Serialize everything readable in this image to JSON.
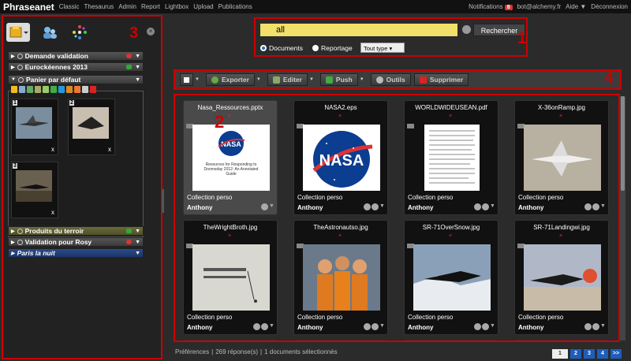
{
  "topbar": {
    "app_name": "Phraseanet",
    "nav": [
      "Classic",
      "Thesaurus",
      "Admin",
      "Report",
      "Lightbox",
      "Upload",
      "Publications"
    ],
    "notifications_label": "Notifications",
    "notifications_count": "8",
    "user": "bot@alchemy.fr",
    "help": "Aide ▼",
    "logout": "Déconnexion"
  },
  "callouts": {
    "search": "1",
    "results": "2",
    "left_panel": "3",
    "toolbar": "4"
  },
  "search": {
    "value": "all",
    "button": "Rechercher",
    "radio_documents": "Documents",
    "radio_reportage": "Reportage",
    "type_select": "Tout type"
  },
  "baskets": {
    "items": [
      {
        "name": "Demande validation",
        "icon": "red"
      },
      {
        "name": "Eurockéennes 2013",
        "icon": "green"
      },
      {
        "name": "Panier par défaut",
        "icon": "none"
      },
      {
        "name": "Produits du terroir",
        "icon": "green"
      },
      {
        "name": "Validation pour Rosy",
        "icon": "red"
      },
      {
        "name": "Paris la nuit",
        "icon": "none"
      }
    ],
    "thumb_numbers": [
      "1",
      "2",
      "3"
    ],
    "remove_label": "x"
  },
  "toolbar": {
    "export": "Exporter",
    "edit": "Editer",
    "push": "Push",
    "tools": "Outils",
    "delete": "Supprimer"
  },
  "results": {
    "cards": [
      {
        "title": "Nasa_Ressources.pptx",
        "collection": "Collection perso",
        "user": "Anthony"
      },
      {
        "title": "NASA2.eps",
        "collection": "Collection perso",
        "user": "Anthony"
      },
      {
        "title": "WORLDWIDEUSEAN.pdf",
        "collection": "Collection perso",
        "user": "Anthony"
      },
      {
        "title": "X-36onRamp.jpg",
        "collection": "Collection perso",
        "user": "Anthony"
      },
      {
        "title": "TheWrightBroth.jpg",
        "collection": "Collection perso",
        "user": "Anthony"
      },
      {
        "title": "TheAstronautso.jpg",
        "collection": "Collection perso",
        "user": "Anthony"
      },
      {
        "title": "SR-71OverSnow.jpg",
        "collection": "Collection perso",
        "user": "Anthony"
      },
      {
        "title": "SR-71Landingwi.jpg",
        "collection": "Collection perso",
        "user": "Anthony"
      }
    ],
    "pptx_slide_text": "Resources for Responding to Doomsday 2012: An Annotated Guide",
    "nasa_logo_text": "NASA"
  },
  "footer": {
    "prefs": "Préférences",
    "count": "269 réponse(s)",
    "selected": "1 documents sélectionnés",
    "sep": "|",
    "pages": [
      "1",
      "2",
      "3",
      "4",
      ">>"
    ]
  }
}
